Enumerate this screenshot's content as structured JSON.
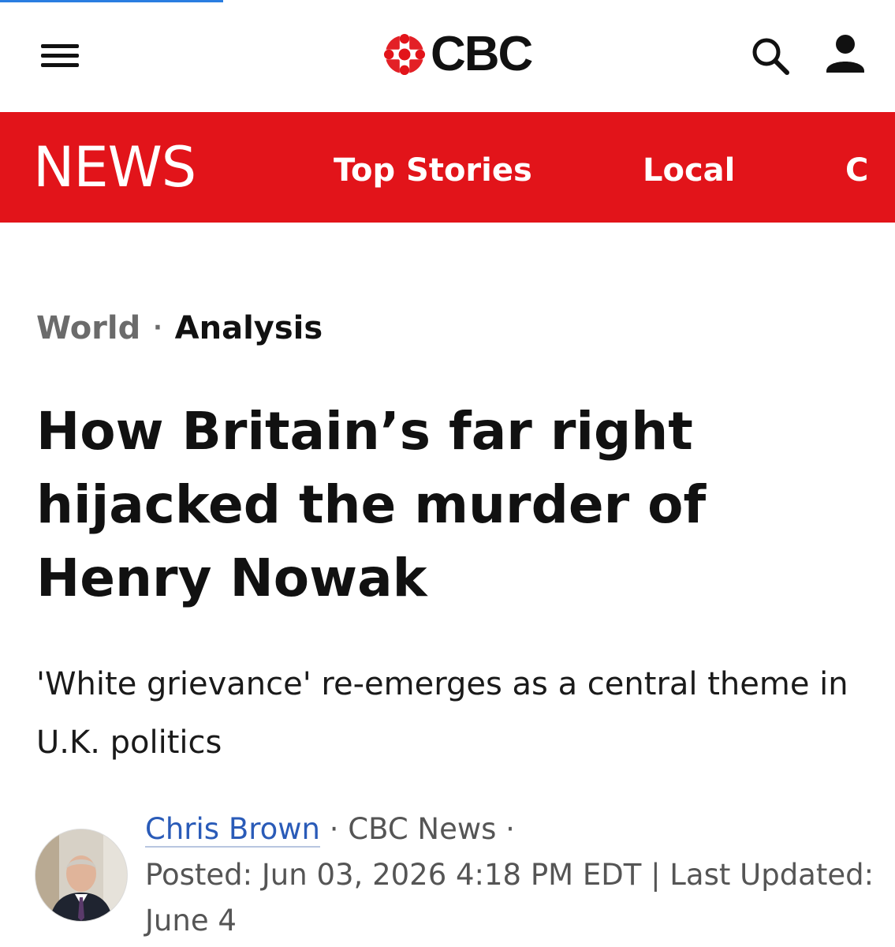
{
  "header": {
    "brand": "CBC"
  },
  "newsbar": {
    "brand": "NEWS",
    "nav": [
      "Top Stories",
      "Local",
      "C"
    ]
  },
  "breadcrumb": {
    "section": "World",
    "separator": "·",
    "label": "Analysis"
  },
  "article": {
    "headline": "How Britain’s far right hijacked the murder of Henry Nowak",
    "deck": "'White grievance' re-emerges as a central theme in U.K. politics",
    "byline": {
      "author": "Chris Brown",
      "sep1": " · ",
      "outlet": "CBC News",
      "sep2": " ·",
      "posted": "Posted: Jun 03, 2026 4:18 PM EDT | Last Updated: June 4"
    }
  },
  "icons": {
    "menu": "hamburger-menu-icon",
    "logo": "cbc-gem-icon",
    "search": "search-icon",
    "account": "user-account-icon"
  },
  "colors": {
    "brand_red": "#e2141a",
    "link_blue": "#2a5bb8",
    "breadcrumb_gray": "#6b6b6b"
  }
}
